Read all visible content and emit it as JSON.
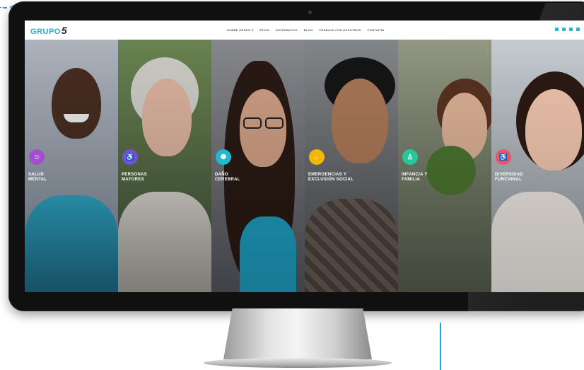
{
  "colors": {
    "accent": "#1fb3d6",
    "salud": "#a64ccf",
    "personas": "#7b4dd6",
    "dano": "#21b8d4",
    "emergencias": "#f3b800",
    "infancia": "#27c59a",
    "diversidad": "#e6566d"
  },
  "site": {
    "logo_text": "GRUPO",
    "logo_number": "5",
    "nav": [
      "SOBRE GRUPO 5",
      "ÉTICA",
      "INFORMATIVO",
      "BLOG",
      "TRABAJA CON NOSOTROS",
      "CONTACTA"
    ],
    "social_icons": [
      "facebook-icon",
      "twitter-icon",
      "linkedin-icon",
      "mail-icon"
    ]
  },
  "panels": [
    {
      "label_line1": "SALUD",
      "label_line2": "MENTAL",
      "icon": "head-icon",
      "color": "#a64ccf"
    },
    {
      "label_line1": "PERSONAS",
      "label_line2": "MAYORES",
      "icon": "elderly-icon",
      "color": "#7b4dd6"
    },
    {
      "label_line1": "DAÑO",
      "label_line2": "CEREBRAL",
      "icon": "brain-icon",
      "color": "#21b8d4"
    },
    {
      "label_line1": "EMERGENCIAS Y",
      "label_line2": "EXCLUSIÓN SOCIAL",
      "icon": "hands-icon",
      "color": "#f3b800"
    },
    {
      "label_line1": "INFANCIA Y",
      "label_line2": "FAMILIA",
      "icon": "child-icon",
      "color": "#27c59a"
    },
    {
      "label_line1": "DIVERSIDAD",
      "label_line2": "FUNCIONAL",
      "icon": "wheelchair-icon",
      "color": "#e6566d"
    }
  ]
}
